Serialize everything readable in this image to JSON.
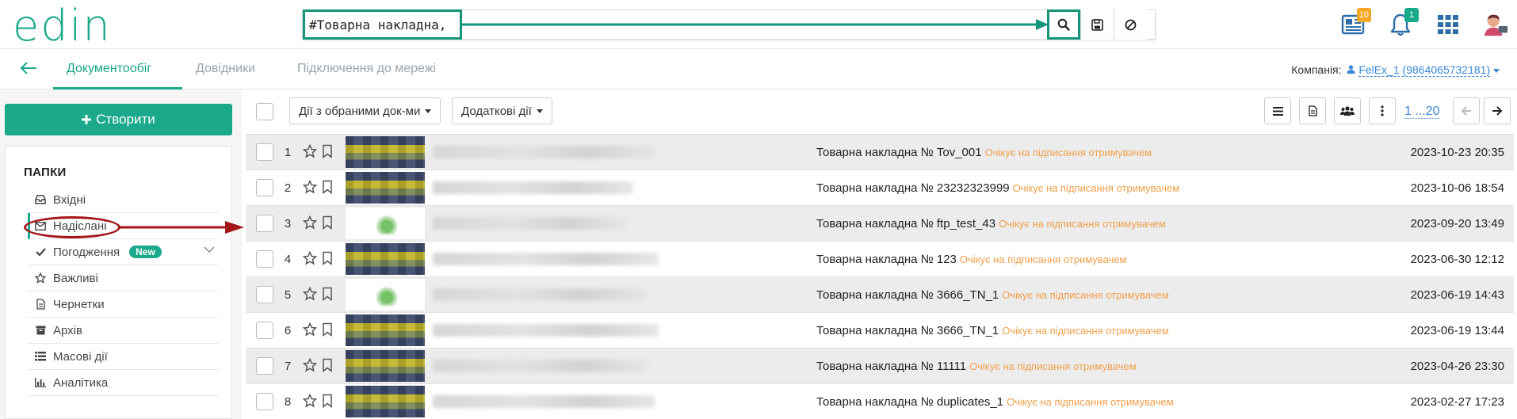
{
  "app": {
    "logo_text": "edin"
  },
  "search": {
    "value": "#Товарна накладна,",
    "search_icon": "search-icon",
    "save_icon": "save-icon",
    "clear_icon": "ban-icon"
  },
  "header_icons": {
    "news": {
      "icon": "newspaper-icon",
      "badge": "10",
      "badge_color": "#f5a623"
    },
    "notifications": {
      "icon": "bell-icon",
      "badge": "1",
      "badge_color": "#1aa98b"
    },
    "apps": {
      "icon": "grid-icon"
    },
    "profile": {
      "icon": "avatar-icon"
    }
  },
  "nav": {
    "back_icon": "arrow-left-icon",
    "tabs": [
      "Документообіг",
      "Довідники",
      "Підключення до мережі"
    ],
    "active_tab": 0,
    "company_label": "Компанія:",
    "company_value": "FelEx_1 (9864065732181)"
  },
  "sidebar": {
    "create_label": "Створити",
    "folders_title": "ПАПКИ",
    "items": [
      {
        "label": "Вхідні",
        "icon": "inbox-icon"
      },
      {
        "label": "Надіслані",
        "icon": "envelope-icon",
        "active": true
      },
      {
        "label": "Погодження",
        "icon": "check-icon",
        "badge": "New"
      },
      {
        "label": "Важливі",
        "icon": "star-icon"
      },
      {
        "label": "Чернетки",
        "icon": "file-icon"
      },
      {
        "label": "Архів",
        "icon": "archive-icon"
      },
      {
        "label": "Масові дії",
        "icon": "list-icon"
      },
      {
        "label": "Аналітика",
        "icon": "bar-chart-icon"
      }
    ]
  },
  "toolbar": {
    "bulk_actions_label": "Дії з обраними док-ми",
    "extra_actions_label": "Додаткові дії",
    "pager_text": "1 ...20"
  },
  "colors": {
    "accent": "#1aa98b",
    "status": "#f0a04b",
    "annotation_red": "#a4161a",
    "link": "#3a86d8"
  },
  "documents": [
    {
      "num": "1",
      "title": "Товарна накладна № Tov_001",
      "status": "Очікує на підписання отримувачем",
      "date": "2023-10-23 20:35"
    },
    {
      "num": "2",
      "title": "Товарна накладна № 23232323999",
      "status": "Очікує на підписання отримувачем",
      "date": "2023-10-06 18:54"
    },
    {
      "num": "3",
      "title": "Товарна накладна № ftp_test_43",
      "status": "Очікує на підписання отримувачем",
      "date": "2023-09-20 13:49"
    },
    {
      "num": "4",
      "title": "Товарна накладна № 123",
      "status": "Очікує на підписання отримувачем",
      "date": "2023-06-30 12:12"
    },
    {
      "num": "5",
      "title": "Товарна накладна № 3666_TN_1",
      "status": "Очікує на підписання отримувачем",
      "date": "2023-06-19 14:43"
    },
    {
      "num": "6",
      "title": "Товарна накладна № 3666_TN_1",
      "status": "Очікує на підписання отримувачем",
      "date": "2023-06-19 13:44"
    },
    {
      "num": "7",
      "title": "Товарна накладна № 11111",
      "status": "Очікує на підписання отримувачем",
      "date": "2023-04-26 23:30"
    },
    {
      "num": "8",
      "title": "Товарна накладна № duplicates_1",
      "status": "Очікує на підписання отримувачем",
      "date": "2023-02-27 17:23"
    }
  ]
}
